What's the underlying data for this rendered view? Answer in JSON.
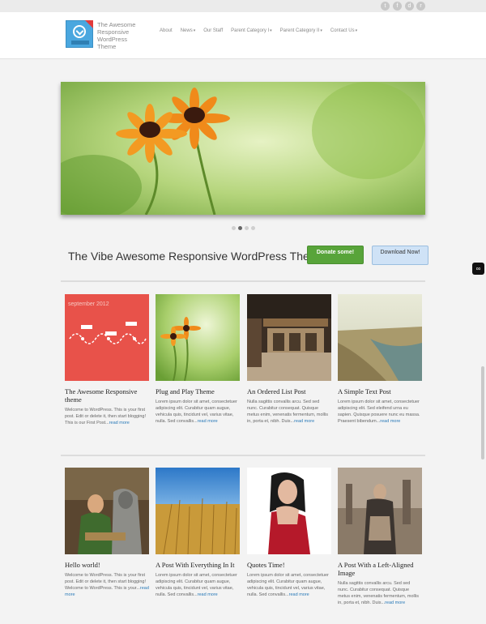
{
  "site": {
    "title": "The Awesome Responsive WordPress Theme",
    "logo_label": "vThem"
  },
  "social": [
    "twitter-icon",
    "facebook-icon",
    "dribbble-icon",
    "rss-icon"
  ],
  "nav": [
    {
      "label": "About",
      "dropdown": false
    },
    {
      "label": "News",
      "dropdown": true
    },
    {
      "label": "Our Staff",
      "dropdown": false
    },
    {
      "label": "Parent Category I",
      "dropdown": true
    },
    {
      "label": "Parent Category II",
      "dropdown": true
    },
    {
      "label": "Contact Us",
      "dropdown": true
    }
  ],
  "slider": {
    "dot_count": 4,
    "active_dot": 1
  },
  "cta": {
    "tagline": "The Vibe Awesome Responsive WordPress Theme »",
    "donate": "Donate some!",
    "download": "Download Now!"
  },
  "more_label": "read more",
  "posts_row1": [
    {
      "title": "The Awesome Responsive theme",
      "excerpt": "Welcome to WordPress. This is your first post. Edit or delete it, then start blogging! This is our First Post...",
      "thumb_text": "september 2012"
    },
    {
      "title": "Plug and Play Theme",
      "excerpt": "Lorem ipsum dolor sit amet, consectetuer adipiscing elit. Curabitur quam augue, vehicula quis, tincidunt vel, varius vitae, nulla. Sed convallis..."
    },
    {
      "title": "An Ordered List Post",
      "excerpt": "Nulla sagittis convallis arcu. Sed sed nunc. Curabitur consequat. Quisque metus enim, venenatis fermentum, mollis in, porta et, nibh. Duis..."
    },
    {
      "title": "A Simple Text Post",
      "excerpt": "Lorem ipsum dolor sit amet, consectetuer adipiscing elit. Sed eleifend urna eu sapien. Quisque posuere nunc eu massa. Praesent bibendum..."
    }
  ],
  "posts_row2": [
    {
      "title": "Hello world!",
      "excerpt": "Welcome to WordPress. This is your first post. Edit or delete it, then start blogging! Welcome to WordPress. This is your..."
    },
    {
      "title": "A Post With Everything In It",
      "excerpt": "Lorem ipsum dolor sit amet, consectetuer adipiscing elit. Curabitur quam augue, vehicula quis, tincidunt vel, varius vitae, nulla. Sed convallis..."
    },
    {
      "title": "Quotes Time!",
      "excerpt": "Lorem ipsum dolor sit amet, consectetuer adipiscing elit. Curabitur quam augue, vehicula quis, tincidunt vel, varius vitae, nulla. Sed convallis..."
    },
    {
      "title": "A Post With a Left-Aligned Image",
      "excerpt": "Nulla sagittis convallis arcu. Sed sed nunc. Curabitur consequat. Quisque metus enim, venenatis fermentum, mollis in, porta et, nibh. Duis..."
    }
  ],
  "colors": {
    "accent": "#58a43a",
    "link": "#2a7ab8",
    "download_bg": "#cfe2f6"
  }
}
